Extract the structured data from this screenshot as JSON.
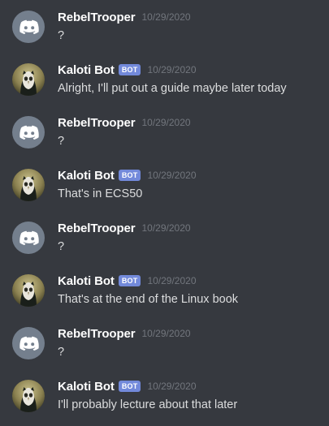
{
  "messages": [
    {
      "author": "RebelTrooper",
      "avatar": "discord-default-icon",
      "bot": false,
      "time": "10/29/2020",
      "text": "?"
    },
    {
      "author": "Kaloti Bot",
      "avatar": "owl-avatar",
      "bot": true,
      "bot_label": "BOT",
      "time": "10/29/2020",
      "text": "Alright, I'll put out a guide maybe later today"
    },
    {
      "author": "RebelTrooper",
      "avatar": "discord-default-icon",
      "bot": false,
      "time": "10/29/2020",
      "text": "?"
    },
    {
      "author": "Kaloti Bot",
      "avatar": "owl-avatar",
      "bot": true,
      "bot_label": "BOT",
      "time": "10/29/2020",
      "text": "That's in ECS50"
    },
    {
      "author": "RebelTrooper",
      "avatar": "discord-default-icon",
      "bot": false,
      "time": "10/29/2020",
      "text": "?"
    },
    {
      "author": "Kaloti Bot",
      "avatar": "owl-avatar",
      "bot": true,
      "bot_label": "BOT",
      "time": "10/29/2020",
      "text": "That's at the end of the Linux book"
    },
    {
      "author": "RebelTrooper",
      "avatar": "discord-default-icon",
      "bot": false,
      "time": "10/29/2020",
      "text": "?"
    },
    {
      "author": "Kaloti Bot",
      "avatar": "owl-avatar",
      "bot": true,
      "bot_label": "BOT",
      "time": "10/29/2020",
      "text": "I'll probably lecture about that later"
    }
  ],
  "colors": {
    "background": "#36393f",
    "bot_tag": "#7289da",
    "default_avatar": "#747f8d"
  }
}
